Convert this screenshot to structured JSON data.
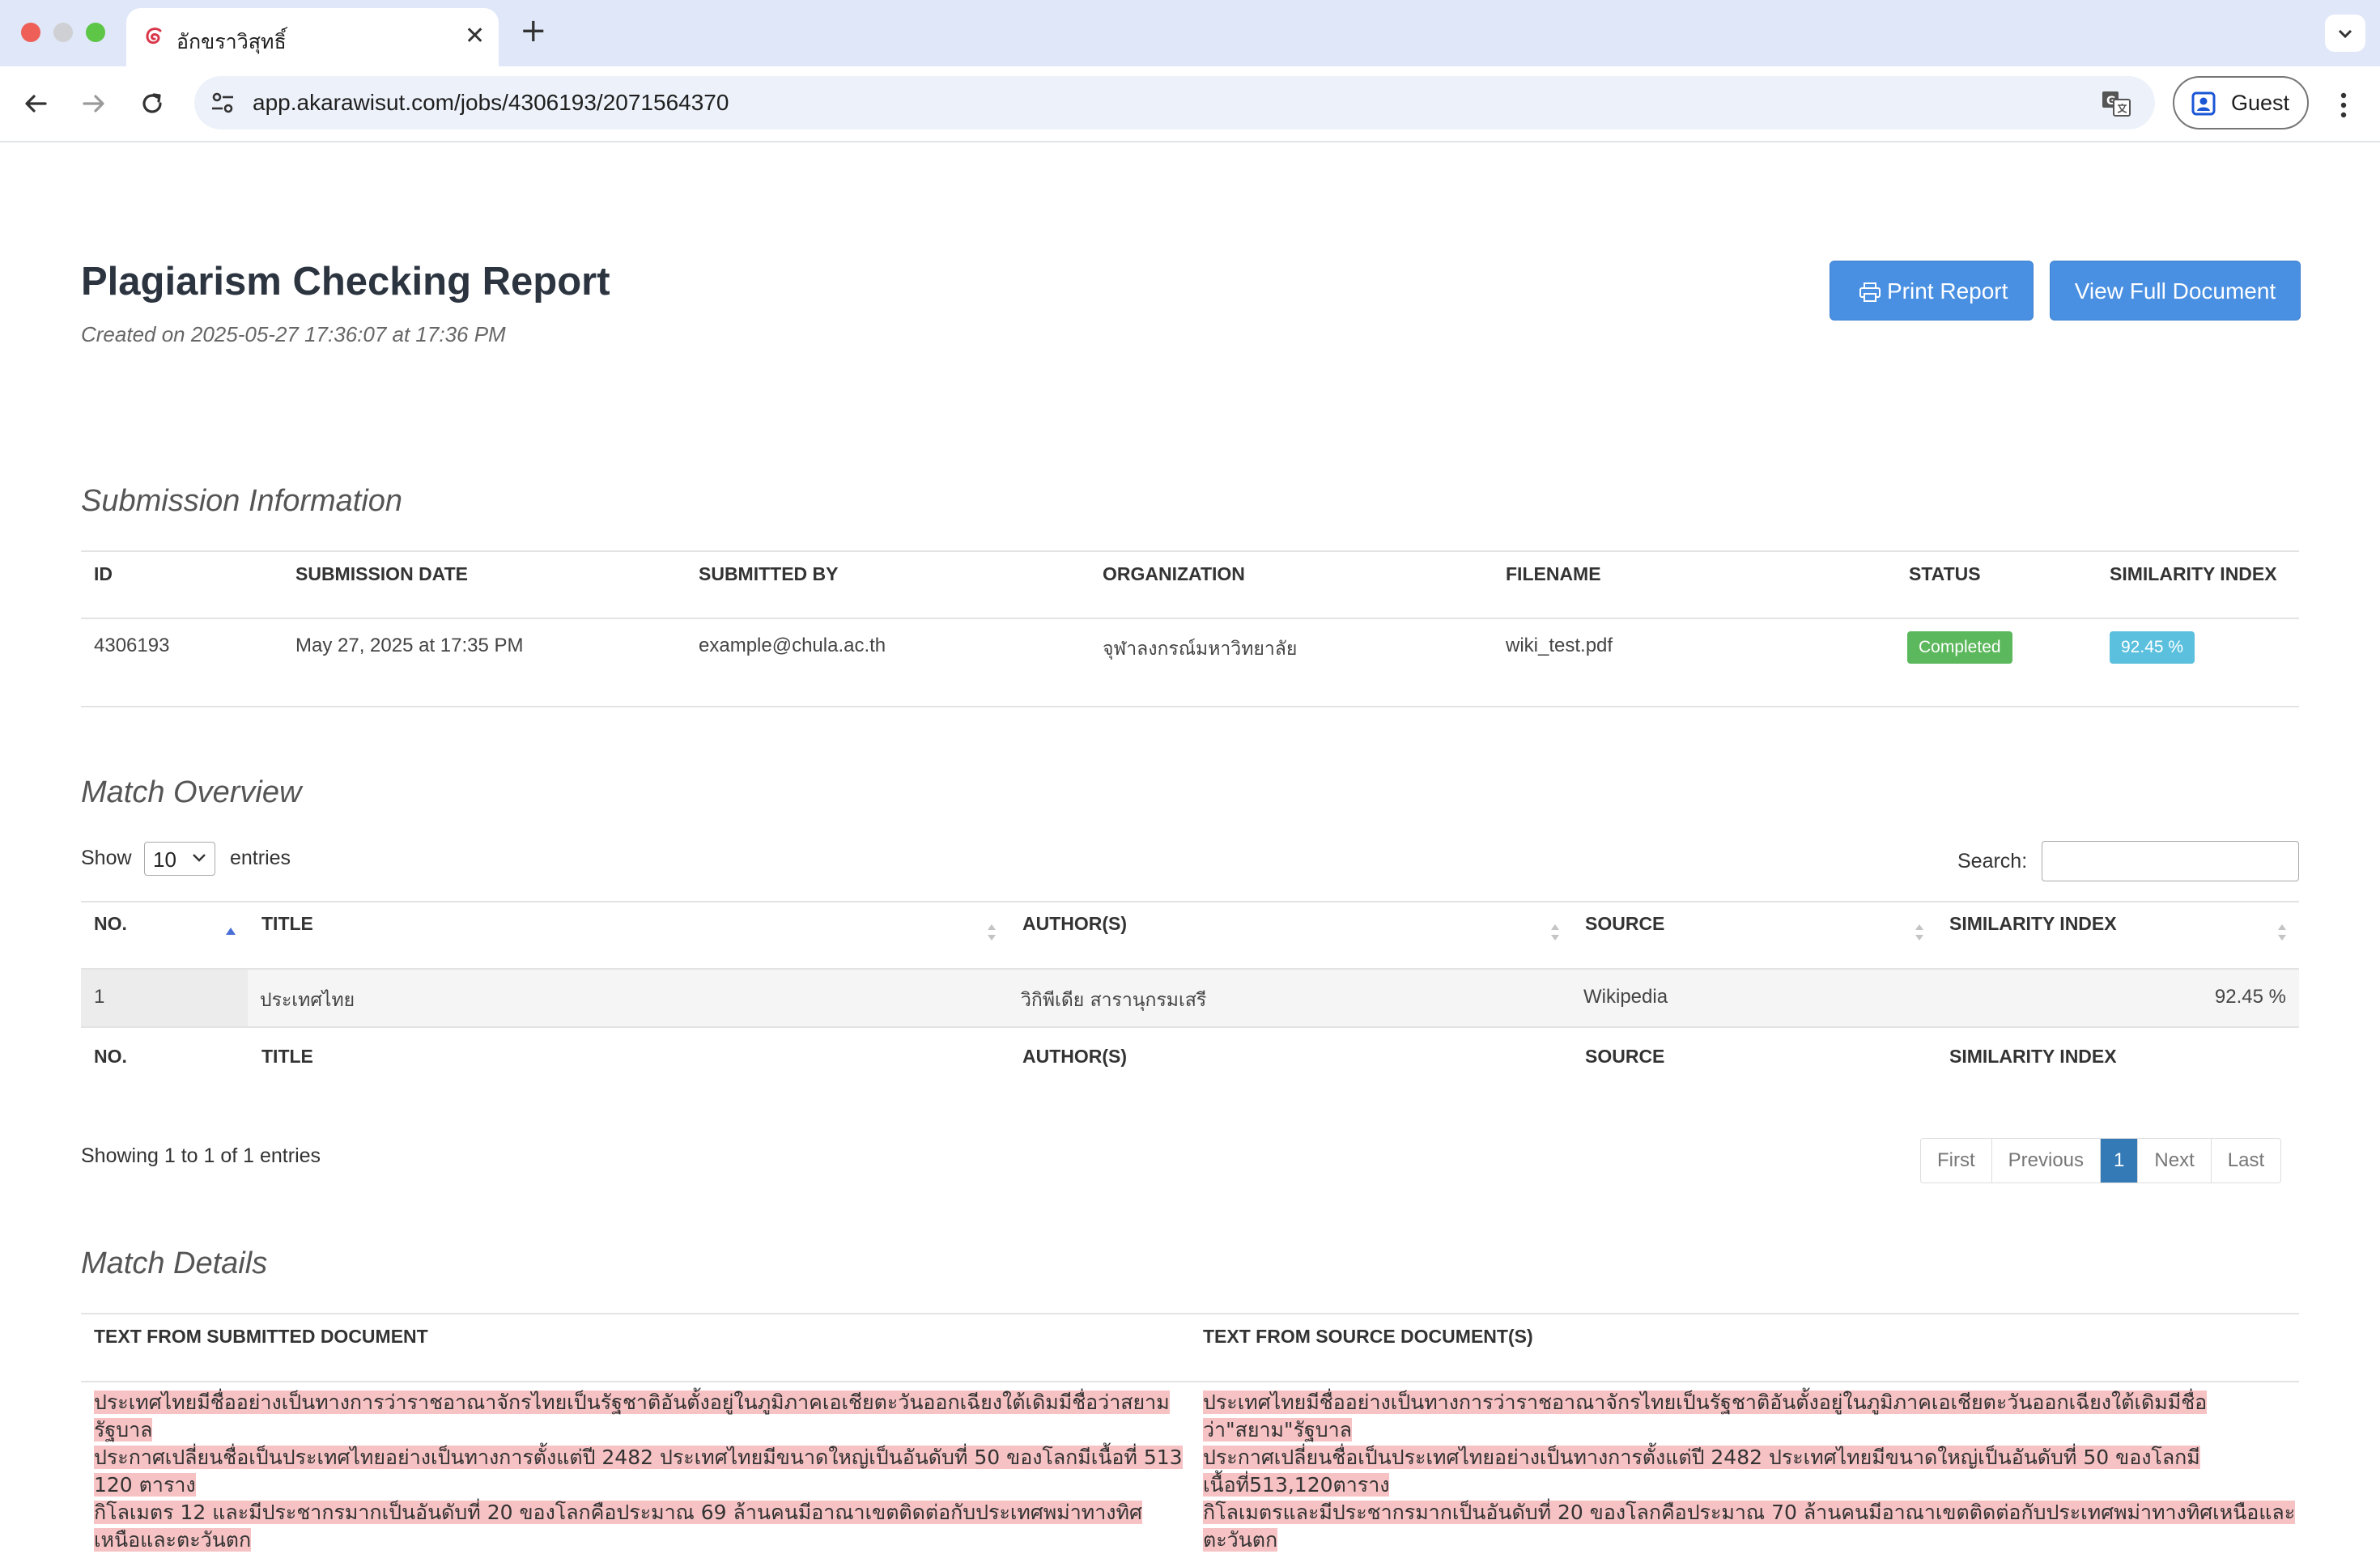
{
  "browser": {
    "tab_title": "อักขราวิสุทธิ์",
    "url": "app.akarawisut.com/jobs/4306193/2071564370",
    "profile_label": "Guest",
    "accent": "#4a90e2"
  },
  "header": {
    "title": "Plagiarism Checking Report",
    "created": "Created on 2025-05-27 17:36:07 at 17:36 PM",
    "print_label": "Print Report",
    "view_label": "View Full Document"
  },
  "submission": {
    "section_title": "Submission Information",
    "columns": [
      "ID",
      "SUBMISSION DATE",
      "SUBMITTED BY",
      "ORGANIZATION",
      "FILENAME",
      "STATUS",
      "SIMILARITY INDEX"
    ],
    "row": {
      "id": "4306193",
      "date": "May 27, 2025 at 17:35 PM",
      "submitted_by": "example@chula.ac.th",
      "organization": "จุฬาลงกรณ์มหาวิทยาลัย",
      "filename": "wiki_test.pdf",
      "status": "Completed",
      "similarity": "92.45 %"
    }
  },
  "overview": {
    "section_title": "Match Overview",
    "show_label": "Show",
    "entries_value": "10",
    "entries_label": "entries",
    "search_label": "Search:",
    "columns": [
      "NO.",
      "TITLE",
      "AUTHOR(S)",
      "SOURCE",
      "SIMILARITY INDEX"
    ],
    "rows": [
      {
        "no": "1",
        "title": "ประเทศไทย",
        "authors": "วิกิพีเดีย สารานุกรมเสรี",
        "source": "Wikipedia",
        "similarity": "92.45 %"
      }
    ],
    "showing": "Showing 1 to 1 of 1 entries",
    "pagination": [
      "First",
      "Previous",
      "1",
      "Next",
      "Last"
    ]
  },
  "details": {
    "section_title": "Match Details",
    "col_submitted": "TEXT FROM SUBMITTED DOCUMENT",
    "col_source": "TEXT FROM SOURCE DOCUMENT(S)",
    "submitted_lines": [
      "ประเทศไทยมีชื่ออย่างเป็นทางการว่าราชอาณาจักรไทยเป็นรัฐชาติอันตั้งอยู่ในภูมิภาคเอเชียตะวันออกเฉียงใต้เดิมมีชื่อว่าสยามรัฐบาล",
      "ประกาศเปลี่ยนชื่อเป็นประเทศไทยอย่างเป็นทางการตั้งแต่ปี 2482 ประเทศไทยมีขนาดใหญ่เป็นอันดับที่ 50 ของโลกมีเนื้อที่ 513 120 ตาราง",
      "กิโลเมตร 12 และมีประชากรมากเป็นอันดับที่ 20 ของโลกคือประมาณ 69 ล้านคนมีอาณาเขตติดต่อกับประเทศพม่าทางทิศเหนือและตะวันตก"
    ],
    "source_lines": [
      "ประเทศไทยมีชื่ออย่างเป็นทางการว่าราชอาณาจักรไทยเป็นรัฐชาติอันตั้งอยู่ในภูมิภาคเอเชียตะวันออกเฉียงใต้เดิมมีชื่อว่า\"สยาม\"รัฐบาล",
      "ประกาศเปลี่ยนชื่อเป็นประเทศไทยอย่างเป็นทางการตั้งแต่ปี 2482 ประเทศไทยมีขนาดใหญ่เป็นอันดับที่ 50 ของโลกมีเนื้อที่513,120ตาราง",
      "กิโลเมตรและมีประชากรมากเป็นอันดับที่ 20 ของโลกคือประมาณ 70 ล้านคนมีอาณาเขตติดต่อกับประเทศพม่าทางทิศเหนือและตะวันตก"
    ]
  }
}
